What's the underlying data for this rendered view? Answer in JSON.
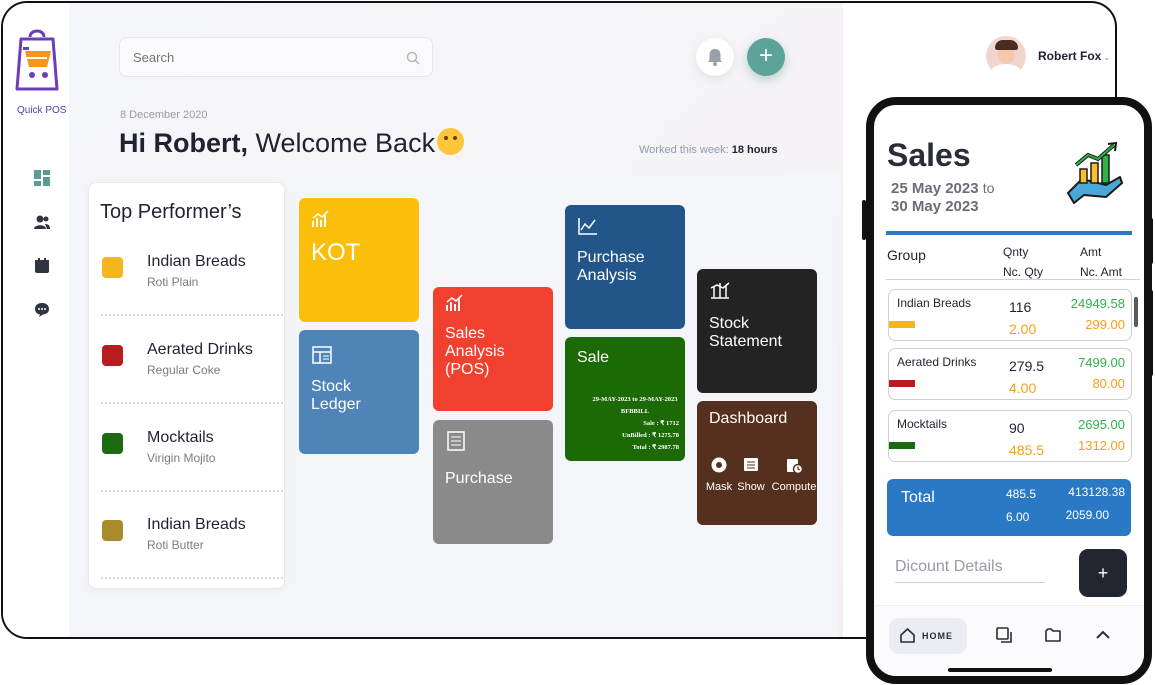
{
  "app": {
    "logo_text": "Quick POS"
  },
  "search": {
    "placeholder": "Search"
  },
  "header": {
    "date": "8 December 2020",
    "greeting_bold": "Hi Robert,",
    "greeting_rest": " Welcome Back",
    "worked_label": "Worked this week:",
    "worked_value": "18 hours"
  },
  "profile": {
    "name": "Robert Fox"
  },
  "sidebar": {
    "items": [
      "dashboard-icon",
      "users-icon",
      "calendar-icon",
      "chat-icon"
    ]
  },
  "performers": {
    "title": "Top Performer’s",
    "items": [
      {
        "name": "Indian Breads",
        "sub": "Roti Plain",
        "color": "#f5b51e"
      },
      {
        "name": "Aerated Drinks",
        "sub": "Regular Coke",
        "color": "#b81d1d"
      },
      {
        "name": "Mocktails",
        "sub": "Virigin Mojito",
        "color": "#1c6a12"
      },
      {
        "name": "Indian Breads",
        "sub": "Roti Butter",
        "color": "#a98a2d"
      }
    ]
  },
  "tiles": {
    "kot": {
      "label": "KOT",
      "color": "#fbbf0b"
    },
    "stock_ledger": {
      "label": "Stock\nLedger",
      "color": "#4f84b8"
    },
    "sales_analysis": {
      "label": "Sales\nAnalysis\n(POS)",
      "color": "#f2402e"
    },
    "purchase": {
      "label": "Purchase",
      "color": "#8a8a8a"
    },
    "purchase_analysis": {
      "label": "Purchase\nAnalysis",
      "color": "#22568b"
    },
    "sale": {
      "label": "Sale",
      "color": "#1c6a05",
      "range": "29-MAY-2023 to 29-MAY-2023",
      "bill": "BFBBILL",
      "line1": "Sale : ₹    1712",
      "line2": "UnBilled : ₹    1275.78",
      "line3": "Total : ₹    2987.78"
    },
    "stock_statement": {
      "label": "Stock\nStatement",
      "color": "#232323"
    },
    "dashboard": {
      "label": "Dashboard",
      "color": "#56301f",
      "actions": [
        "Mask",
        "Show",
        "Compute"
      ]
    }
  },
  "phone": {
    "title": "Sales",
    "range_from": "25 May 2023",
    "range_to_word": "to",
    "range_to": "30 May 2023",
    "headers": {
      "group": "Group",
      "qnty": "Qnty",
      "nc_qty": "Nc. Qty",
      "amt": "Amt",
      "nc_amt": "Nc. Amt"
    },
    "rows": [
      {
        "group": "Indian Breads",
        "qty": "116",
        "nc_qty": "2.00",
        "amt": "24949.58",
        "nc_amt": "299.00",
        "color": "#f5b51e"
      },
      {
        "group": "Aerated Drinks",
        "qty": "279.5",
        "nc_qty": "4.00",
        "amt": "7499.00",
        "nc_amt": "80.00",
        "color": "#b81d1d"
      },
      {
        "group": "Mocktails",
        "qty": "90",
        "nc_qty": "485.5",
        "amt": "2695.00",
        "nc_amt": "1312.00",
        "color": "#1c6a12"
      }
    ],
    "total": {
      "label": "Total",
      "qty": "485.5",
      "nc_qty": "6.00",
      "amt": "413128.38",
      "nc_amt": "2059.00"
    },
    "discount_label": "Dicount Details",
    "fab": "+",
    "nav": {
      "home": "HOME"
    },
    "accent": "#2a79c4"
  }
}
